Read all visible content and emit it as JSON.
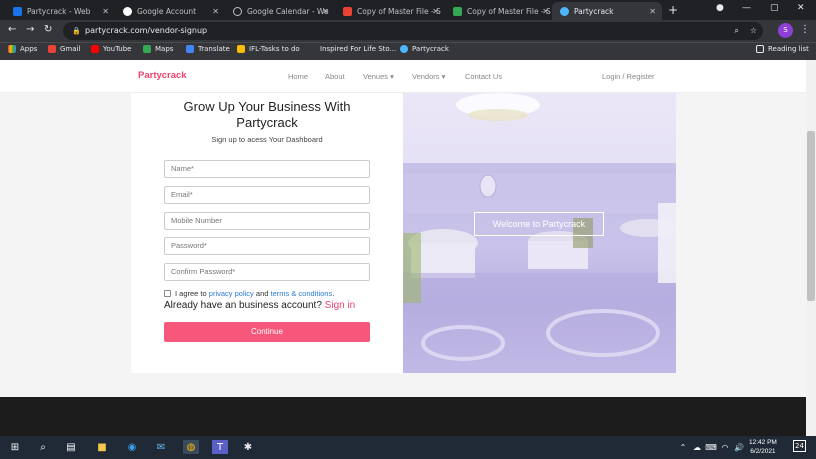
{
  "tabs": [
    {
      "label": "Partycrack - Web",
      "color": "#1a73e8"
    },
    {
      "label": "Google Account",
      "color": "#ea4335"
    },
    {
      "label": "Google Calendar - We",
      "color": "#4285f4"
    },
    {
      "label": "Copy of Master File - S",
      "color": "#ea4335"
    },
    {
      "label": "Copy of Master File - S",
      "color": "#34a853"
    },
    {
      "label": "Partycrack",
      "color": "#4db6ff"
    }
  ],
  "url": "partycrack.com/vendor-signup",
  "profile_initial": "S",
  "bookmarks": [
    "Apps",
    "Gmail",
    "YouTube",
    "Maps",
    "Translate",
    "IFL-Tasks to do",
    "Inspired For Life Sto...",
    "Partycrack"
  ],
  "reading_list": "Reading list",
  "site": {
    "brand": "Partycrack",
    "nav": [
      "Home",
      "About",
      "Venues ▾",
      "Vendors ▾",
      "Contact Us"
    ],
    "login": "Login / Register",
    "title_line1": "Grow Up Your Business With",
    "title_line2": "Partycrack",
    "subtitle": "Sign up to acess Your Dashboard",
    "fields": [
      "Name*",
      "Email*",
      "Mobile Number",
      "Password*",
      "Confirm Password*"
    ],
    "agree_prefix": "I agree to",
    "privacy": "privacy policy",
    "and": "and",
    "terms": "terms & conditions",
    "dot": ".",
    "already": "Already have an business account?",
    "signin": "Sign in",
    "continue": "Continue",
    "welcome": "Welcome to Partycrack"
  },
  "taskbar": {
    "time": "12:42 PM",
    "date": "6/2/2021",
    "notif": "24"
  }
}
